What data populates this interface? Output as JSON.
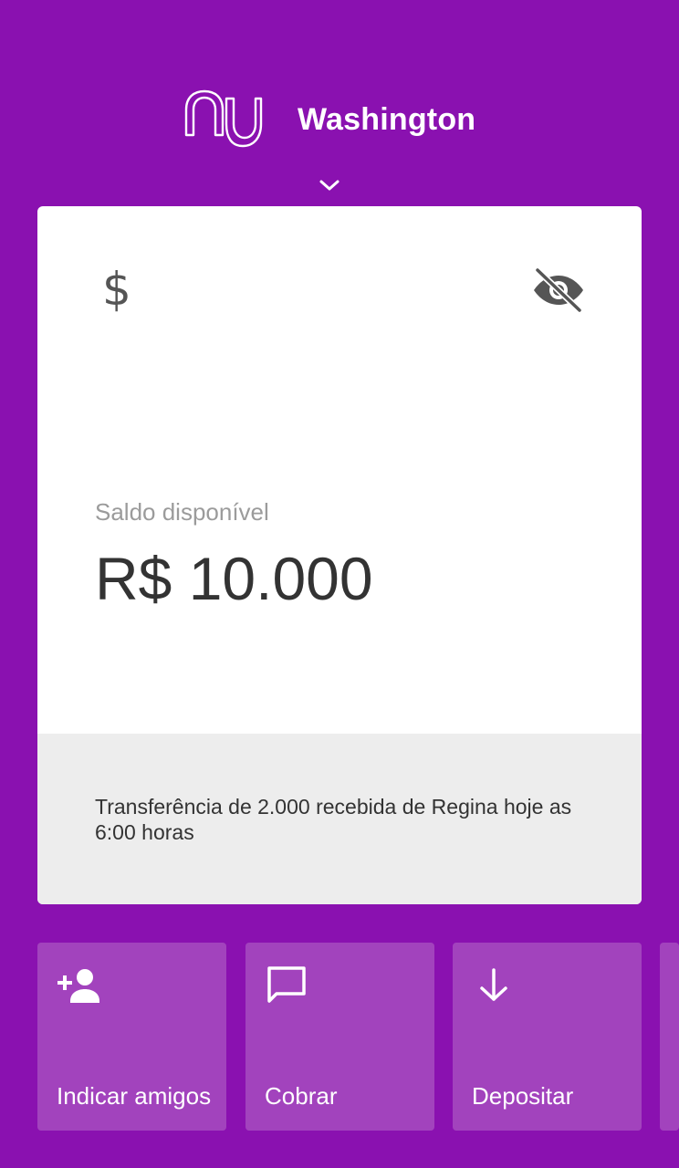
{
  "header": {
    "logo_icon": "nubank-logo-icon",
    "user_name": "Washington",
    "expand_icon": "chevron-down-icon"
  },
  "card": {
    "icon": "dollar-icon",
    "icon_glyph": "$",
    "visibility_icon": "eye-off-icon",
    "balance_label": "Saldo disponível",
    "balance_value": "R$ 10.000",
    "notification": "Transferência de 2.000 recebida de Regina hoje as 6:00 horas"
  },
  "shortcuts": [
    {
      "label": "Indicar amigos",
      "icon": "person-add-icon"
    },
    {
      "label": "Cobrar",
      "icon": "message-icon"
    },
    {
      "label": "Depositar",
      "icon": "arrow-down-icon"
    }
  ],
  "colors": {
    "background": "#8a11b0",
    "shortcut_background": "#a243bd",
    "card_background": "#ffffff",
    "card_footer_background": "#ededed"
  }
}
